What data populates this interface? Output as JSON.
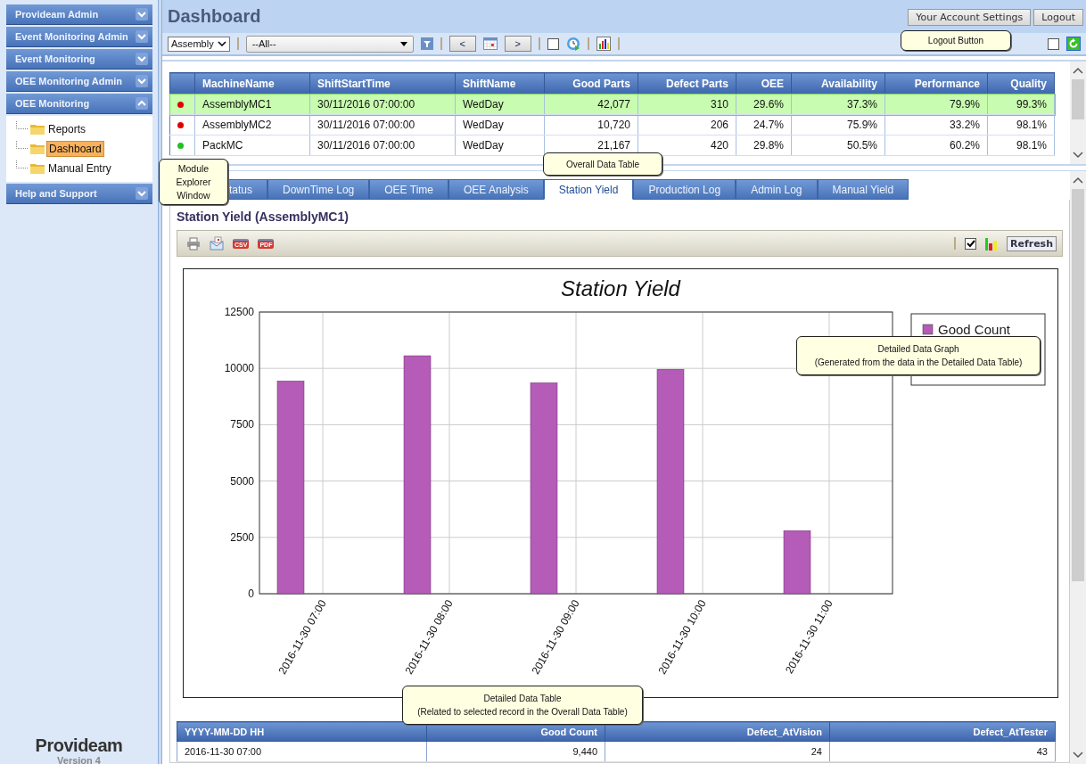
{
  "sidebar": {
    "sections": [
      {
        "label": "Provideam Admin",
        "expanded": false
      },
      {
        "label": "Event Monitoring Admin",
        "expanded": false
      },
      {
        "label": "Event Monitoring",
        "expanded": false
      },
      {
        "label": "OEE Monitoring Admin",
        "expanded": false
      },
      {
        "label": "OEE Monitoring",
        "expanded": true,
        "children": [
          {
            "label": "Reports",
            "selected": false
          },
          {
            "label": "Dashboard",
            "selected": true
          },
          {
            "label": "Manual Entry",
            "selected": false
          }
        ]
      },
      {
        "label": "Help and Support",
        "expanded": false
      }
    ],
    "logo": {
      "name": "Provideam",
      "version": "Version 4"
    }
  },
  "header": {
    "title": "Dashboard",
    "buttons": [
      "Your Account Settings",
      "Logout"
    ]
  },
  "toolbar": {
    "area_select": "Assembly",
    "machine_select": "--All--",
    "prev": "<",
    "next": ">",
    "auto_refresh_checked": false,
    "right_checkbox_checked": false
  },
  "overall_table": {
    "columns": [
      "MachineName",
      "ShiftStartTime",
      "ShiftName",
      "Good Parts",
      "Defect Parts",
      "OEE",
      "Availability",
      "Performance",
      "Quality"
    ],
    "rows": [
      {
        "color": "#e00000",
        "selected": true,
        "cells": [
          "AssemblyMC1",
          "30/11/2016 07:00:00",
          "WedDay",
          "42,077",
          "310",
          "29.6%",
          "37.3%",
          "79.9%",
          "99.3%"
        ]
      },
      {
        "color": "#e00000",
        "selected": false,
        "cells": [
          "AssemblyMC2",
          "30/11/2016 07:00:00",
          "WedDay",
          "10,720",
          "206",
          "24.7%",
          "75.9%",
          "33.2%",
          "98.1%"
        ]
      },
      {
        "color": "#22c022",
        "selected": false,
        "cells": [
          "PackMC",
          "30/11/2016 07:00:00",
          "WedDay",
          "21,167",
          "420",
          "29.8%",
          "50.5%",
          "60.2%",
          "98.1%"
        ]
      }
    ]
  },
  "tabs": [
    {
      "label": "tatus",
      "selected": false
    },
    {
      "label": "DownTime Log",
      "selected": false
    },
    {
      "label": "OEE Time",
      "selected": false
    },
    {
      "label": "OEE Analysis",
      "selected": false
    },
    {
      "label": "Station Yield",
      "selected": true
    },
    {
      "label": "Production Log",
      "selected": false
    },
    {
      "label": "Admin Log",
      "selected": false
    },
    {
      "label": "Manual Yield",
      "selected": false
    }
  ],
  "panel": {
    "title": "Station Yield (AssemblyMC1)",
    "export_icons": [
      "CSV",
      "PDF"
    ],
    "chart_checkbox_checked": true,
    "refresh": "Refresh",
    "chart_data": {
      "type": "bar",
      "title": "Station Yield",
      "categories": [
        "2016-11-30 07:00",
        "2016-11-30 08:00",
        "2016-11-30 09:00",
        "2016-11-30 10:00",
        "2016-11-30 11:00"
      ],
      "series": [
        {
          "name": "Good Count",
          "color": "#b45cb8",
          "values": [
            9440,
            10560,
            9360,
            9960,
            2800
          ]
        }
      ],
      "grid": true,
      "ylim": [
        0,
        12500
      ],
      "yticks": [
        0,
        2500,
        5000,
        7500,
        10000,
        12500
      ]
    }
  },
  "detail_table": {
    "columns": [
      "YYYY-MM-DD HH",
      "Good Count",
      "Defect_AtVision",
      "Defect_AtTester"
    ],
    "rows": [
      [
        "2016-11-30 07:00",
        "9,440",
        "24",
        "43"
      ]
    ]
  },
  "callouts": [
    {
      "kind": "module",
      "lines": [
        "Module",
        "Explorer",
        "Window"
      ]
    },
    {
      "kind": "overall",
      "lines": [
        "Overall Data Table"
      ]
    },
    {
      "kind": "logout",
      "lines": [
        "Logout Button"
      ]
    },
    {
      "kind": "graph",
      "lines": [
        "Detailed Data Graph",
        "(Generated from the data in the Detailed Data Table)"
      ]
    },
    {
      "kind": "detail",
      "lines": [
        "Detailed Data Table",
        "(Related to selected record in the Overall Data Table)"
      ]
    }
  ]
}
